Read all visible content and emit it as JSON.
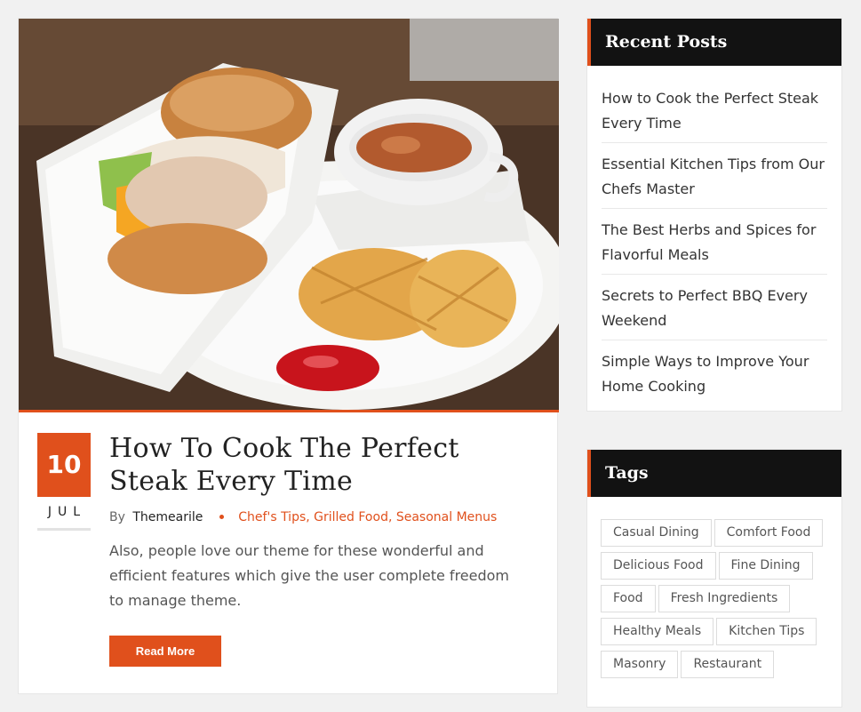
{
  "post": {
    "image_alt": "Burger with waffle fries, ketchup and a cup of soup on a white plate",
    "day": "10",
    "month": "JUL",
    "title": "How To Cook The Perfect Steak Every Time",
    "by_label": "By",
    "author": "Themearile",
    "categories": "Chef's Tips, Grilled Food, Seasonal Menus",
    "excerpt": "Also, people love our theme for these wonderful and efficient features which give the user complete freedom to manage theme.",
    "read_more": "Read More"
  },
  "recent_posts": {
    "title": "Recent Posts",
    "items": [
      "How to Cook the Perfect Steak Every Time",
      "Essential Kitchen Tips from Our Chefs Master",
      "The Best Herbs and Spices for Flavorful Meals",
      "Secrets to Perfect BBQ Every Weekend",
      "Simple Ways to Improve Your Home Cooking"
    ]
  },
  "tags": {
    "title": "Tags",
    "items": [
      "Casual Dining",
      "Comfort Food",
      "Delicious Food",
      "Fine Dining",
      "Food",
      "Fresh Ingredients",
      "Healthy Meals",
      "Kitchen Tips",
      "Masonry",
      "Restaurant"
    ]
  },
  "colors": {
    "accent": "#e0501c",
    "widget_header": "#121212",
    "background": "#f1f1f1"
  }
}
